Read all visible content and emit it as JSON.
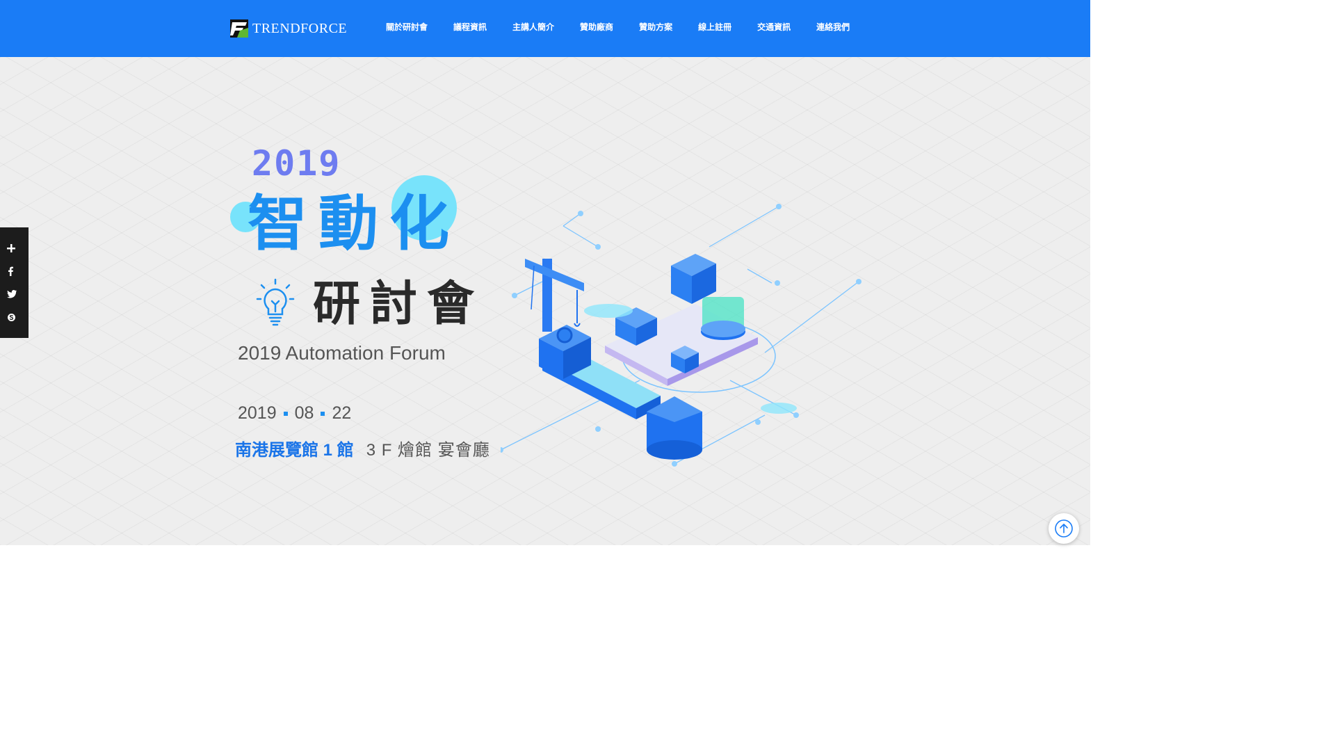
{
  "header": {
    "logo_text": "TRENDFORCE",
    "nav": [
      {
        "label": "關於研討會"
      },
      {
        "label": "議程資訊"
      },
      {
        "label": "主講人簡介"
      },
      {
        "label": "贊助廠商"
      },
      {
        "label": "贊助方案"
      },
      {
        "label": "線上註冊"
      },
      {
        "label": "交通資訊"
      },
      {
        "label": "連絡我們"
      }
    ]
  },
  "hero": {
    "year": "2019",
    "title": "智動化",
    "subtitle": "研討會",
    "forum_name": "2019 Automation Forum",
    "date": {
      "year": "2019",
      "month": "08",
      "day": "22"
    },
    "venue_main": "南港展覽館 1 館",
    "venue_detail": "3 F 燴館 宴會廳"
  },
  "social": {
    "icons": [
      "plus-icon",
      "facebook-icon",
      "twitter-icon",
      "skype-icon"
    ]
  },
  "colors": {
    "header_bg": "#1a7cf6",
    "title_blue": "#1c8ff0",
    "year_purple": "#6e7cf0",
    "accent_cyan": "#78e3fb"
  }
}
